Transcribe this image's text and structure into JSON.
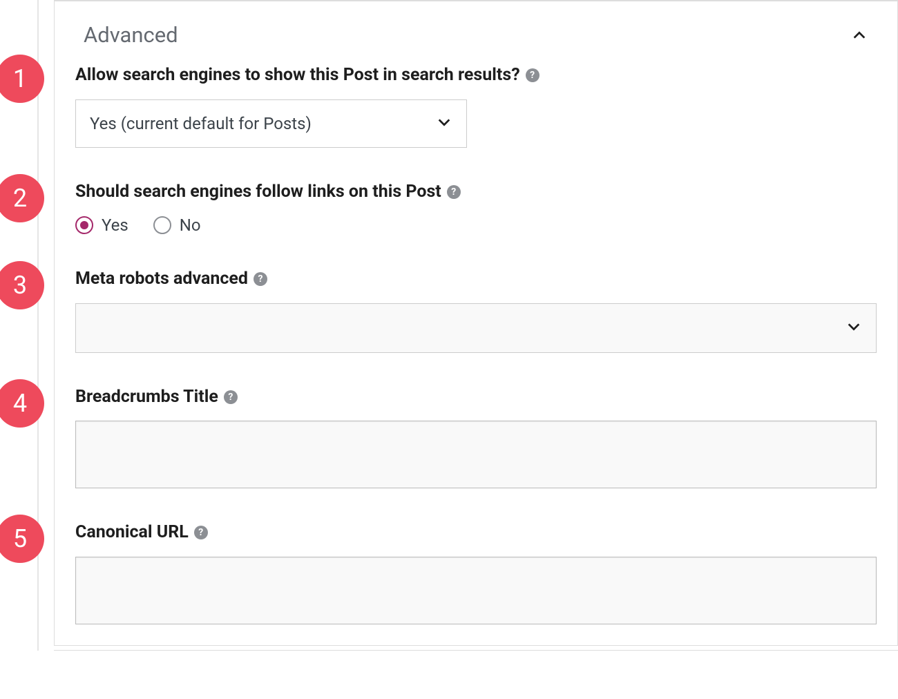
{
  "section": {
    "title": "Advanced"
  },
  "annotations": {
    "b1": "1",
    "b2": "2",
    "b3": "3",
    "b4": "4",
    "b5": "5"
  },
  "fields": {
    "allow_search": {
      "label": "Allow search engines to show this Post in search results?",
      "value": "Yes (current default for Posts)"
    },
    "follow_links": {
      "label": "Should search engines follow links on this Post",
      "options": {
        "yes": "Yes",
        "no": "No"
      },
      "selected": "yes"
    },
    "meta_robots": {
      "label": "Meta robots advanced",
      "value": ""
    },
    "breadcrumbs": {
      "label": "Breadcrumbs Title",
      "value": ""
    },
    "canonical": {
      "label": "Canonical URL",
      "value": ""
    }
  },
  "help_glyph": "?"
}
